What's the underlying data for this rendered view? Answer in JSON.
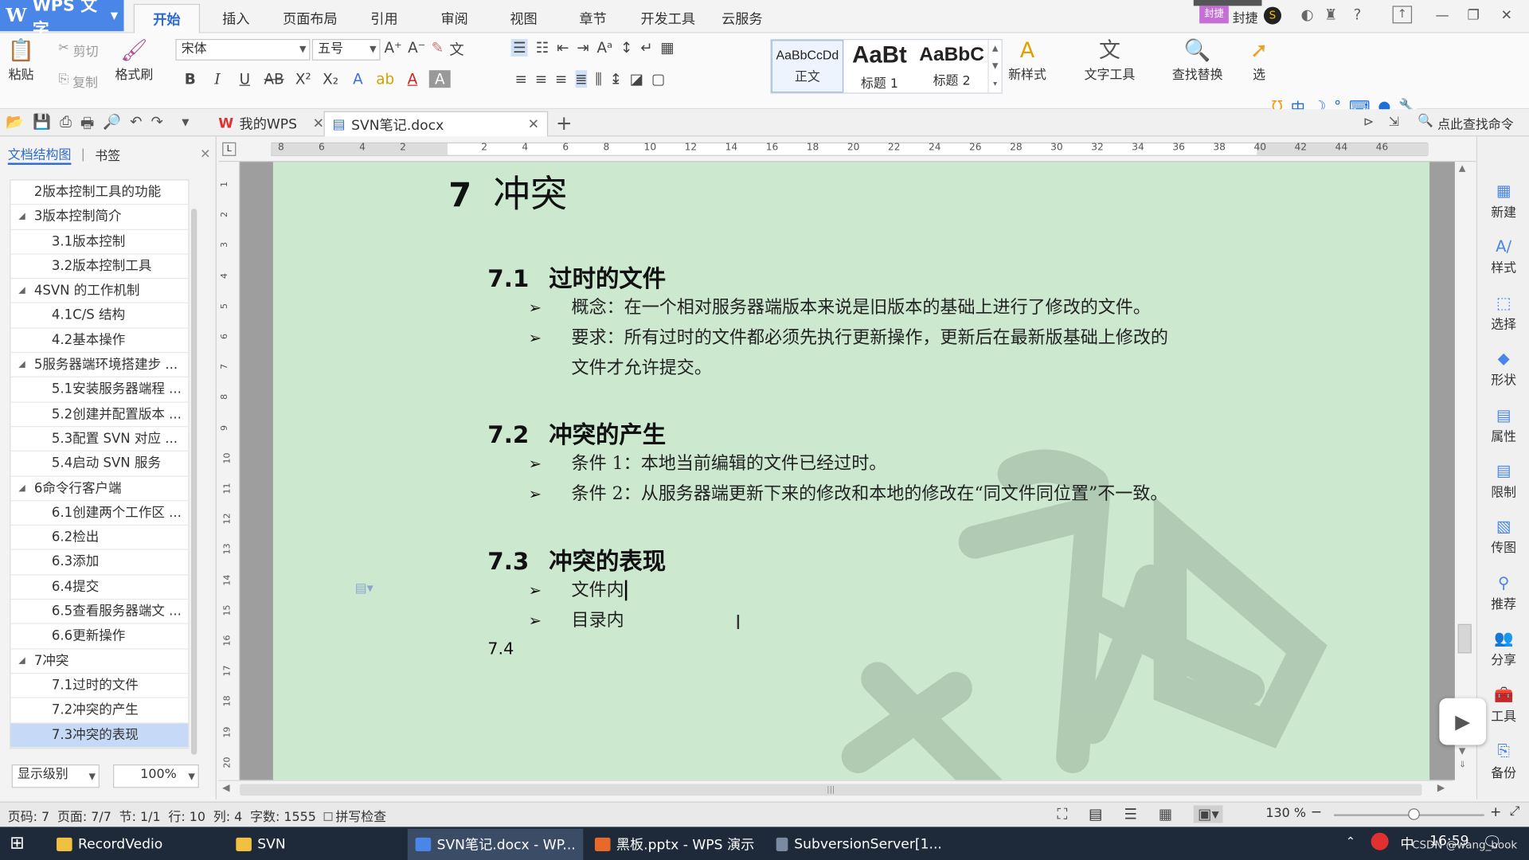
{
  "app": {
    "name": "WPS 文字"
  },
  "menu_tabs": [
    "开始",
    "插入",
    "页面布局",
    "引用",
    "审阅",
    "视图",
    "章节",
    "开发工具",
    "云服务"
  ],
  "top_right": {
    "user": "封捷",
    "help": "?"
  },
  "ribbon": {
    "paste": "粘贴",
    "cut": "剪切",
    "copy": "复制",
    "format_painter": "格式刷",
    "font": "宋体",
    "size": "五号",
    "styles": [
      {
        "preview": "AaBbCcDd",
        "label": "正文"
      },
      {
        "preview": "AaBt",
        "label": "标题 1"
      },
      {
        "preview": "AaBbC",
        "label": "标题 2"
      }
    ],
    "new_style": "新样式",
    "text_tools": "文字工具",
    "find_replace": "查找替换",
    "select": "选"
  },
  "doc_tabs": [
    {
      "label": "我的WPS"
    },
    {
      "label": "SVN笔记.docx"
    }
  ],
  "search_cmd": "点此查找命令",
  "nav": {
    "tabs": [
      "文档结构图",
      "书签"
    ],
    "items": [
      {
        "label": "2版本控制工具的功能",
        "level": 1,
        "tri": ""
      },
      {
        "label": "3版本控制简介",
        "level": 1,
        "tri": "◢"
      },
      {
        "label": "3.1版本控制",
        "level": 2,
        "tri": ""
      },
      {
        "label": "3.2版本控制工具",
        "level": 2,
        "tri": ""
      },
      {
        "label": "4SVN 的工作机制",
        "level": 1,
        "tri": "◢"
      },
      {
        "label": "4.1C/S 结构",
        "level": 2,
        "tri": ""
      },
      {
        "label": "4.2基本操作",
        "level": 2,
        "tri": ""
      },
      {
        "label": "5服务器端环境搭建步 ...",
        "level": 1,
        "tri": "◢"
      },
      {
        "label": "5.1安装服务器端程 ...",
        "level": 2,
        "tri": ""
      },
      {
        "label": "5.2创建并配置版本 ...",
        "level": 2,
        "tri": ""
      },
      {
        "label": "5.3配置 SVN 对应 ...",
        "level": 2,
        "tri": ""
      },
      {
        "label": "5.4启动 SVN 服务",
        "level": 2,
        "tri": ""
      },
      {
        "label": "6命令行客户端",
        "level": 1,
        "tri": "◢"
      },
      {
        "label": "6.1创建两个工作区 ...",
        "level": 2,
        "tri": ""
      },
      {
        "label": "6.2检出",
        "level": 2,
        "tri": ""
      },
      {
        "label": "6.3添加",
        "level": 2,
        "tri": ""
      },
      {
        "label": "6.4提交",
        "level": 2,
        "tri": ""
      },
      {
        "label": "6.5查看服务器端文 ...",
        "level": 2,
        "tri": ""
      },
      {
        "label": "6.6更新操作",
        "level": 2,
        "tri": ""
      },
      {
        "label": "7冲突",
        "level": 1,
        "tri": "◢"
      },
      {
        "label": "7.1过时的文件",
        "level": 2,
        "tri": ""
      },
      {
        "label": "7.2冲突的产生",
        "level": 2,
        "tri": ""
      },
      {
        "label": "7.3冲突的表现",
        "level": 2,
        "tri": "",
        "selected": true
      }
    ],
    "level_select": "显示级别",
    "zoom_select": "100%"
  },
  "doc": {
    "h1_num": "7",
    "h1_text": "冲突",
    "s1_num": "7.1",
    "s1_text": "过时的文件",
    "s1_b1": "概念：在一个相对服务器端版本来说是旧版本的基础上进行了修改的文件。",
    "s1_b2a": "要求：所有过时的文件都必须先执行更新操作，更新后在最新版基础上修改的",
    "s1_b2b": "文件才允许提交。",
    "s2_num": "7.2",
    "s2_text": "冲突的产生",
    "s2_b1": "条件 1：本地当前编辑的文件已经过时。",
    "s2_b2": "条件 2：从服务器端更新下来的修改和本地的修改在“同文件同位置”不一致。",
    "s3_num": "7.3",
    "s3_text": "冲突的表现",
    "s3_b1": "文件内",
    "s3_b2": "目录内",
    "s4_num": "7.4"
  },
  "hruler_labels": [
    "8",
    "6",
    "4",
    "2",
    "",
    "2",
    "4",
    "6",
    "8",
    "10",
    "12",
    "14",
    "16",
    "18",
    "20",
    "22",
    "24",
    "26",
    "28",
    "30",
    "32",
    "34",
    "36",
    "38",
    "40",
    "42",
    "44",
    "46"
  ],
  "vruler_labels": [
    "1",
    "2",
    "3",
    "4",
    "5",
    "6",
    "7",
    "8",
    "9",
    "10",
    "11",
    "12",
    "13",
    "14",
    "15",
    "16",
    "17",
    "18",
    "19",
    "20"
  ],
  "right_panel": [
    "新建",
    "样式",
    "选择",
    "形状",
    "属性",
    "限制",
    "传图",
    "推荐",
    "分享",
    "工具",
    "备份"
  ],
  "status": {
    "page_code": "页码: 7",
    "page": "页面: 7/7",
    "section": "节: 1/1",
    "row": "行: 10",
    "col": "列: 4",
    "words": "字数: 1555",
    "spell": "拼写检查",
    "zoom": "130 %"
  },
  "taskbar": {
    "items": [
      "RecordVedio",
      "SVN",
      "SVN笔记.docx - WP...",
      "黑板.pptx - WPS 演示",
      "SubversionServer[1..."
    ],
    "ime": "中",
    "time": "16:59",
    "watermark": "CSDN @wang_book"
  },
  "colors": {
    "accent": "#2c6bd1",
    "app_blue": "#4a86e8",
    "page_bg": "#cce8cf",
    "taskbar": "#1e2a3a"
  }
}
